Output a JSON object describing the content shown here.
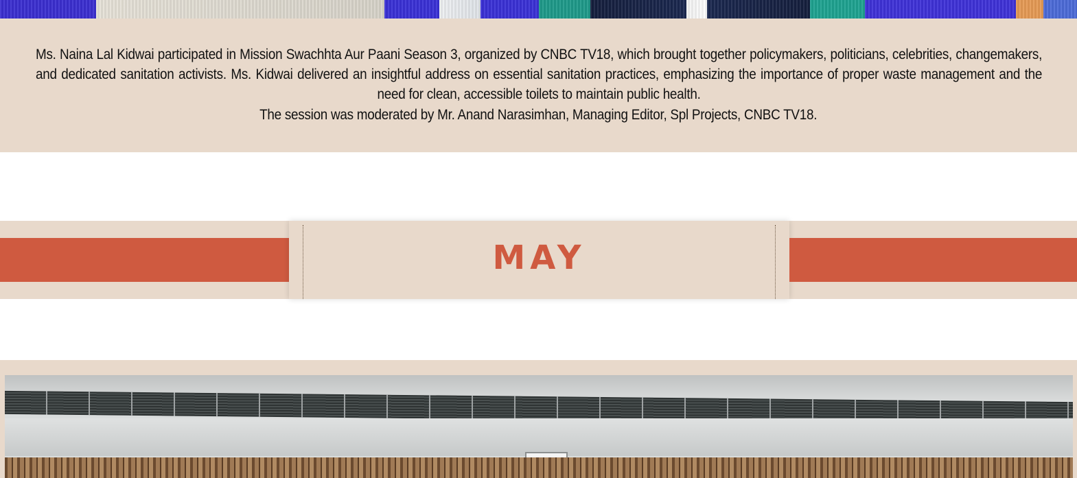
{
  "caption": {
    "paragraph": "Ms. Naina Lal Kidwai participated in Mission Swachhta Aur Paani Season 3, organized by CNBC TV18, which brought together policymakers, politicians, celebrities, changemakers, and dedicated sanitation activists. Ms. Kidwai delivered an insightful address on essential sanitation practices, emphasizing the importance of proper waste management and the need for clean, accessible toilets to maintain public health.",
    "moderator_line": "The session was moderated by Mr. Anand Narasimhan, Managing Editor, Spl Projects, CNBC TV18."
  },
  "month_divider": {
    "label": "MAY"
  },
  "colors": {
    "band_background": "#e8d9cb",
    "accent": "#cf5a40",
    "text": "#111111"
  }
}
